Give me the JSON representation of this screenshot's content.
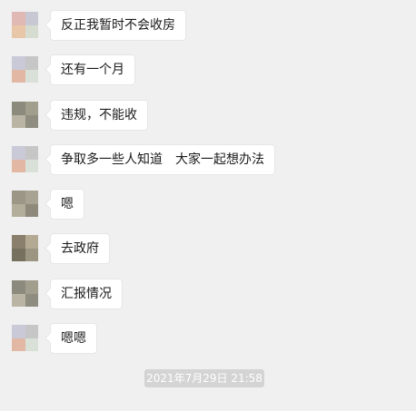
{
  "messages": [
    {
      "text": "反正我暂时不会收房",
      "avatar": [
        "#e0b9b4",
        "#c8c8d4",
        "#e8c7a8",
        "#d6dcd0"
      ]
    },
    {
      "text": "还有一个月",
      "avatar": [
        "#c9c9d8",
        "#c6c6c6",
        "#e2b8a4",
        "#d9e0d8"
      ]
    },
    {
      "text": "违规，不能收",
      "avatar": [
        "#8c8a7c",
        "#a29e8e",
        "#b9b4a4",
        "#8f8d80"
      ]
    },
    {
      "text": "争取多一些人知道　大家一起想办法",
      "avatar": [
        "#c9c9d8",
        "#c6c6c6",
        "#e2b8a4",
        "#d9e0d8"
      ]
    },
    {
      "text": "嗯",
      "avatar": [
        "#9c9686",
        "#a8a293",
        "#b3ad9c",
        "#8e897b"
      ]
    },
    {
      "text": "去政府",
      "avatar": [
        "#8a7f6c",
        "#b4aa94",
        "#76705f",
        "#9c9581"
      ]
    },
    {
      "text": "汇报情况",
      "avatar": [
        "#8c8a7c",
        "#a29e8e",
        "#b9b4a4",
        "#8f8d80"
      ]
    },
    {
      "text": "嗯嗯",
      "avatar": [
        "#c9c9d8",
        "#c6c6c6",
        "#e2b8a4",
        "#d9e0d8"
      ]
    }
  ],
  "timestamp": "2021年7月29日 21:58"
}
